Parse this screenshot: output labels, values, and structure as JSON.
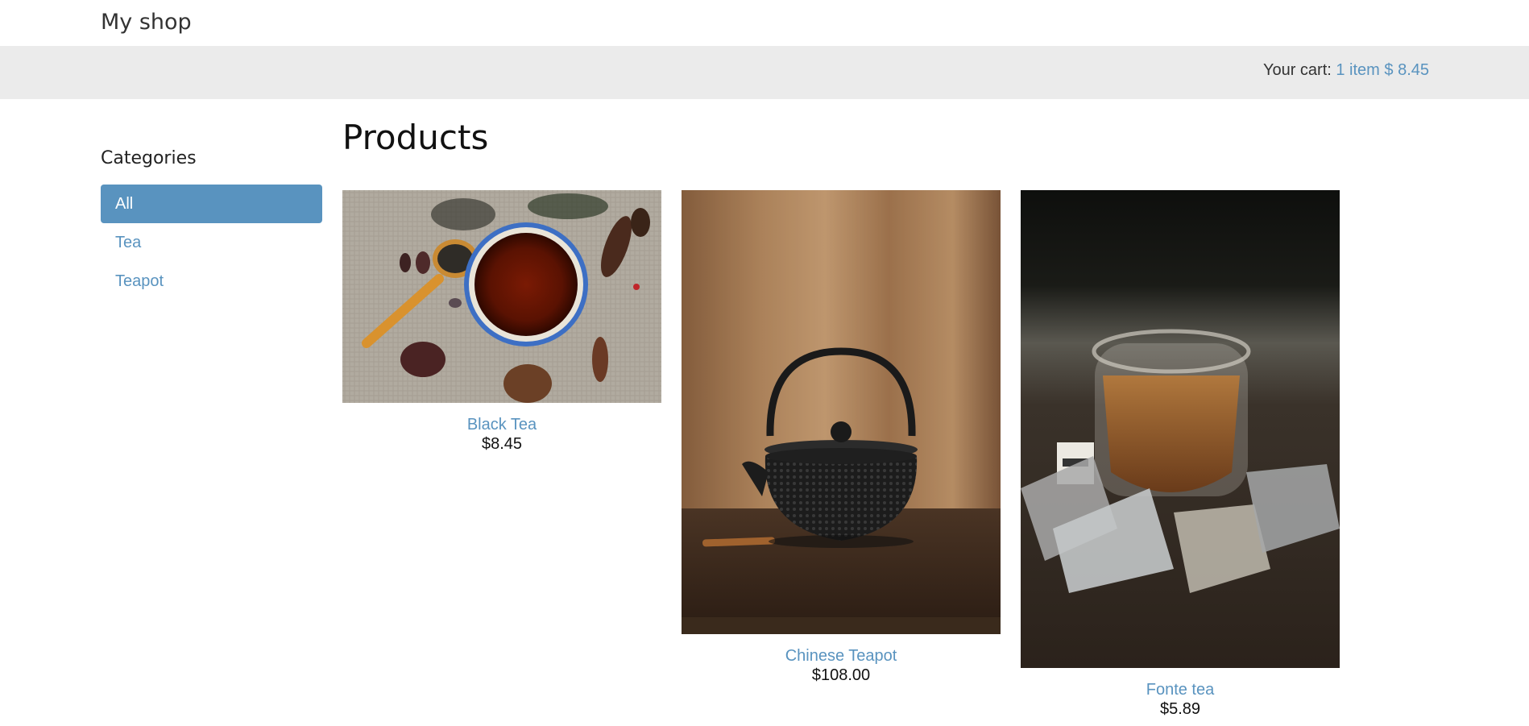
{
  "header": {
    "shop_name": "My shop"
  },
  "cart": {
    "label": "Your cart:",
    "summary": "1 item $ 8.45"
  },
  "sidebar": {
    "title": "Categories",
    "items": [
      {
        "label": "All",
        "active": true
      },
      {
        "label": "Tea",
        "active": false
      },
      {
        "label": "Teapot",
        "active": false
      }
    ]
  },
  "main": {
    "title": "Products",
    "products": [
      {
        "name": "Black Tea",
        "price": "$8.45"
      },
      {
        "name": "Chinese Teapot",
        "price": "$108.00"
      },
      {
        "name": "Fonte tea",
        "price": "$5.89"
      }
    ]
  },
  "colors": {
    "accent": "#5993bf",
    "subheader_bg": "#ebebeb"
  }
}
